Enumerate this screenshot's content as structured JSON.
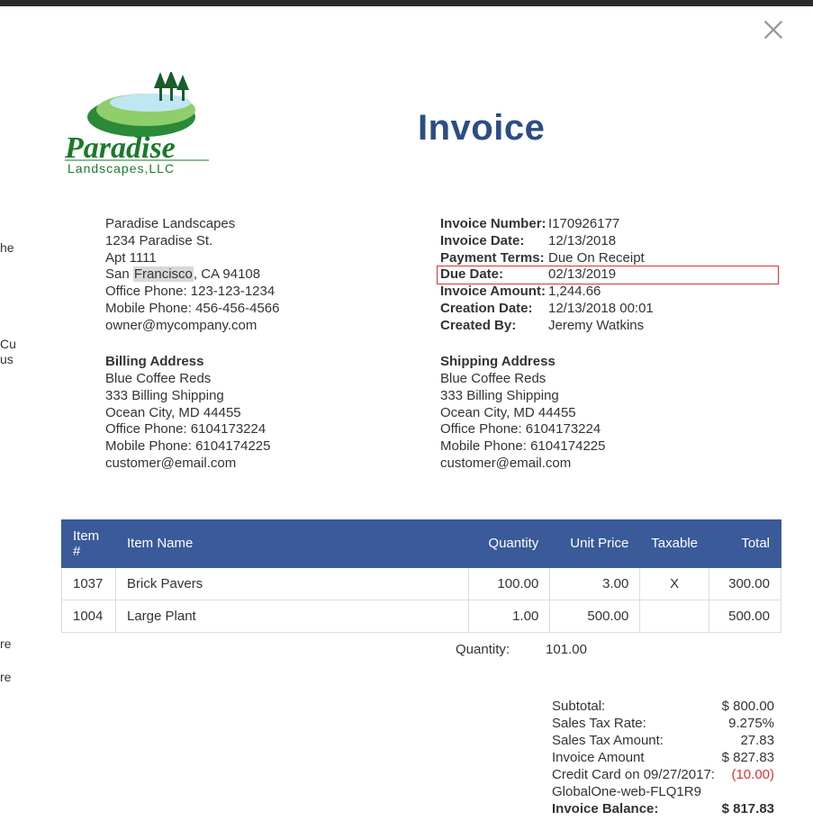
{
  "title": "Invoice",
  "close_label": "Close",
  "left_hints": [
    "he",
    "Cu",
    "us",
    "re",
    "re"
  ],
  "company": {
    "name": "Paradise Landscapes",
    "addr1": "1234 Paradise St.",
    "addr2": "Apt 1111",
    "city_pre": "San ",
    "city_sel": "Francisco",
    "city_post": ", CA 94108",
    "office": "Office Phone: 123-123-1234",
    "mobile": "Mobile Phone: 456-456-4566",
    "email": "owner@mycompany.com",
    "logo_name": "Paradise",
    "logo_sub": "Landscapes,LLC"
  },
  "meta": {
    "rows": [
      {
        "k": "Invoice Number:",
        "v": "I170926177"
      },
      {
        "k": "Invoice Date:",
        "v": "12/13/2018"
      },
      {
        "k": "Payment Terms:",
        "v": "Due On Receipt"
      },
      {
        "k": "Due Date:",
        "v": "02/13/2019",
        "hl": true
      },
      {
        "k": "Invoice Amount:",
        "v": "1,244.66"
      },
      {
        "k": "Creation Date:",
        "v": "12/13/2018 00:01"
      },
      {
        "k": "Created By:",
        "v": "Jeremy Watkins"
      }
    ]
  },
  "billing": {
    "head": "Billing Address",
    "lines": [
      "Blue Coffee Reds",
      "333 Billing Shipping",
      "Ocean City, MD 44455",
      "Office Phone: 6104173224",
      "Mobile Phone: 6104174225",
      "customer@email.com"
    ]
  },
  "shipping": {
    "head": "Shipping Address",
    "lines": [
      "Blue Coffee Reds",
      "333 Billing Shipping",
      "Ocean City, MD 44455",
      "Office Phone: 6104173224",
      "Mobile Phone: 6104174225",
      "customer@email.com"
    ]
  },
  "items": {
    "cols": [
      "Item #",
      "Item Name",
      "Quantity",
      "Unit Price",
      "Taxable",
      "Total"
    ],
    "rows": [
      {
        "num": "1037",
        "name": "Brick Pavers",
        "qty": "100.00",
        "price": "3.00",
        "tax": "X",
        "total": "300.00"
      },
      {
        "num": "1004",
        "name": "Large Plant",
        "qty": "1.00",
        "price": "500.00",
        "tax": "",
        "total": "500.00"
      }
    ],
    "qty_label": "Quantity:",
    "qty_total": "101.00"
  },
  "totals": [
    {
      "label": "Subtotal:",
      "val": "$ 800.00"
    },
    {
      "label": "Sales Tax Rate:",
      "val": "9.275%"
    },
    {
      "label": "Sales Tax Amount:",
      "val": "27.83"
    },
    {
      "label": "Invoice Amount",
      "val": "$ 827.83"
    },
    {
      "label": "Credit Card on 09/27/2017:",
      "val": "(10.00)",
      "neg": true
    },
    {
      "label": "GlobalOne-web-FLQ1R9",
      "val": ""
    },
    {
      "label": "Invoice Balance:",
      "val": "$ 817.83",
      "bold": true
    }
  ]
}
